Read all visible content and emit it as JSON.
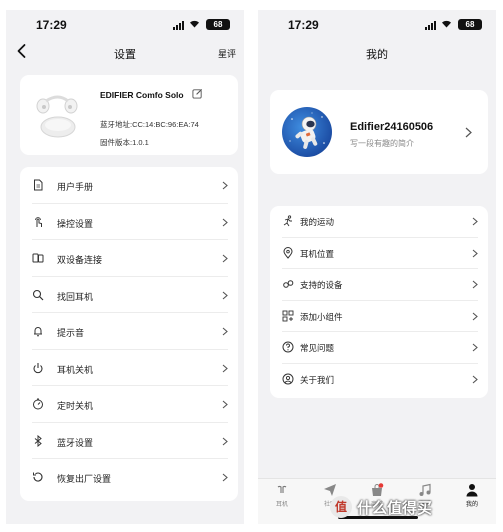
{
  "left_screen": {
    "status": {
      "time": "17:29",
      "battery": "68"
    },
    "nav": {
      "title": "设置",
      "action": "星评"
    },
    "device": {
      "name": "EDIFIER Comfo Solo",
      "bluetooth": "蓝牙地址:CC:14:BC:96:EA:74",
      "firmware": "固件版本:1.0.1"
    },
    "menu": [
      {
        "label": "用户手册",
        "icon": "document-icon"
      },
      {
        "label": "操控设置",
        "icon": "tap-gesture-icon"
      },
      {
        "label": "双设备连接",
        "icon": "dual-device-icon"
      },
      {
        "label": "找回耳机",
        "icon": "search-icon"
      },
      {
        "label": "提示音",
        "icon": "bell-icon"
      },
      {
        "label": "耳机关机",
        "icon": "power-icon"
      },
      {
        "label": "定时关机",
        "icon": "timer-icon"
      },
      {
        "label": "蓝牙设置",
        "icon": "bluetooth-icon"
      },
      {
        "label": "恢复出厂设置",
        "icon": "reset-icon"
      }
    ]
  },
  "right_screen": {
    "status": {
      "time": "17:29",
      "battery": "68"
    },
    "nav": {
      "title": "我的"
    },
    "profile": {
      "username": "Edifier24160506",
      "bio": "写一段有趣的简介"
    },
    "menu": [
      {
        "label": "我的运动",
        "icon": "running-icon"
      },
      {
        "label": "耳机位置",
        "icon": "location-pin-icon"
      },
      {
        "label": "支持的设备",
        "icon": "headphones-icon"
      },
      {
        "label": "添加小组件",
        "icon": "widget-grid-icon"
      },
      {
        "label": "常见问题",
        "icon": "help-circle-icon"
      },
      {
        "label": "关于我们",
        "icon": "user-circle-icon"
      }
    ],
    "tabs": [
      {
        "label": "耳机",
        "icon": "earbuds-tab-icon",
        "active": false
      },
      {
        "label": "社区",
        "icon": "send-tab-icon",
        "active": false
      },
      {
        "label": "商城",
        "icon": "shop-tab-icon",
        "active": false
      },
      {
        "label": "音乐",
        "icon": "music-tab-icon",
        "active": false
      },
      {
        "label": "我的",
        "icon": "person-tab-icon",
        "active": true
      }
    ]
  },
  "watermark": {
    "badge": "值",
    "text": "什么值得买"
  }
}
